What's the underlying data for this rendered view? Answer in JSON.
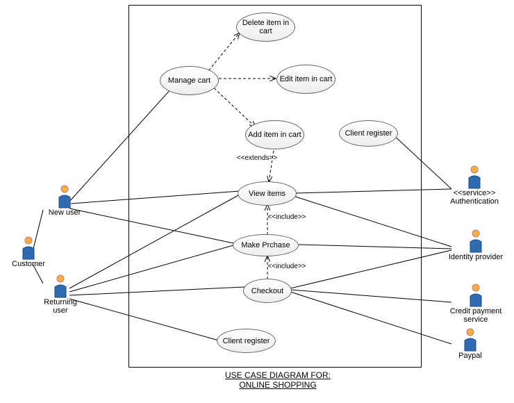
{
  "title_l1": "USE CASE DIAGRAM FOR:",
  "title_l2": "ONLINE SHOPPING",
  "actors": {
    "customer": "Customer",
    "newUser": "New user",
    "returning": "Returning user",
    "auth_stereo": "<<service>>",
    "auth": "Authentication",
    "identity": "Identity provider",
    "credit": "Credit payment service",
    "paypal": "Paypal"
  },
  "uc": {
    "manage": "Manage cart",
    "delete": "Delete item in cart",
    "edit": "Edit item in cart",
    "add": "Add item in cart",
    "view": "View items",
    "make": "Make Prchase",
    "checkout": "Checkout",
    "clientReg1": "Client register",
    "clientReg2": "Client register"
  },
  "rel": {
    "extends": "<<extends>>",
    "include1": "<<include>>",
    "include2": "<<include>>"
  }
}
